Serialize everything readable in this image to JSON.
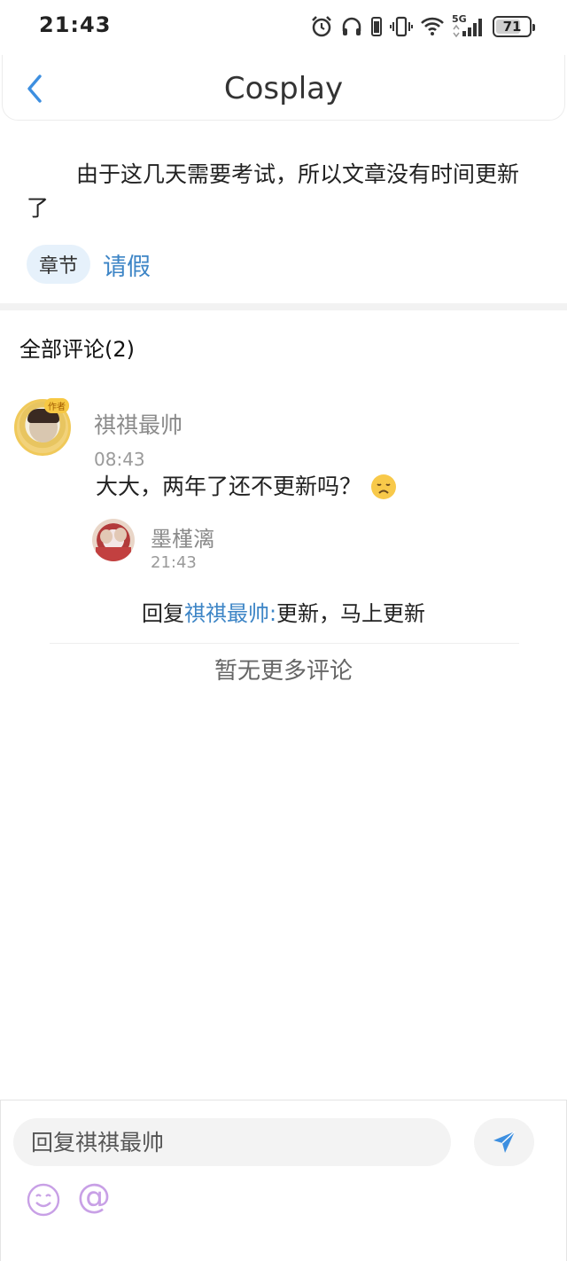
{
  "status_bar": {
    "time": "21:43",
    "battery_level": "71",
    "network": "5G",
    "icons": [
      "alarm-icon",
      "headphones-icon",
      "vibrate-icon",
      "wifi-icon",
      "signal-icon",
      "battery-icon"
    ]
  },
  "header": {
    "title": "Cosplay",
    "back_icon": "chevron-left-icon"
  },
  "article": {
    "text": "由于这几天需要考试，所以文章没有时间更新了",
    "tag_chip": "章节",
    "tag_link": "请假"
  },
  "comments": {
    "title": "全部评论(2)",
    "items": [
      {
        "author": "祺祺最帅",
        "badge": "作者",
        "time": "08:43",
        "text": "大大，两年了还不更新吗？"
      }
    ],
    "reply": {
      "author": "墨槿漓",
      "time": "21:43",
      "prefix": "回复",
      "mention": "祺祺最帅:",
      "text": "更新，马上更新"
    },
    "no_more": "暂无更多评论"
  },
  "bottom_bar": {
    "input_placeholder": "回复祺祺最帅",
    "at_symbol": "@"
  },
  "colors": {
    "accent": "#3d85c6",
    "tag_bg": "#e6f1fb",
    "muted_text": "#8a8a8a",
    "send_icon": "#3d8fe0",
    "emoji_icon": "#c8a0e6"
  }
}
